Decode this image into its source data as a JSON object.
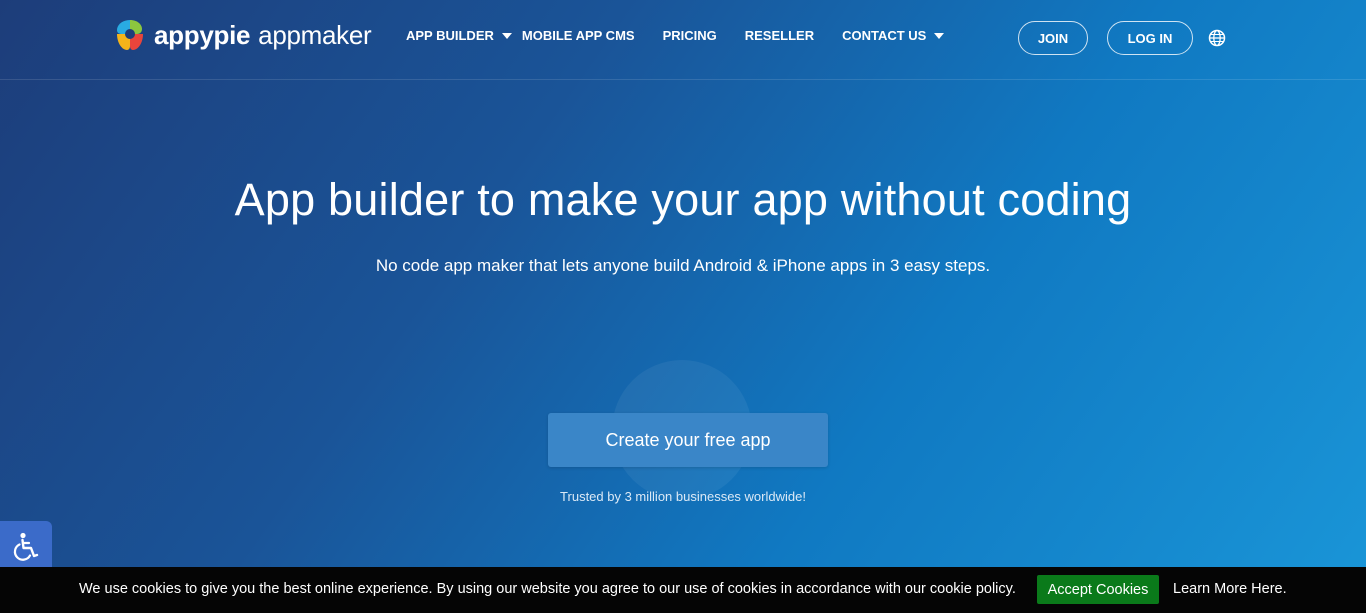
{
  "brand": {
    "name_bold": "appypie",
    "name_light": "appmaker",
    "logo_icon": "appypie-logo-icon",
    "colors": [
      "#f4b41a",
      "#8cc63f",
      "#e8453c",
      "#29abe2"
    ]
  },
  "nav": {
    "items": [
      {
        "label": "APP BUILDER",
        "dropdown": true
      },
      {
        "label": "MOBILE APP CMS",
        "dropdown": false
      },
      {
        "label": "PRICING",
        "dropdown": false
      },
      {
        "label": "RESELLER",
        "dropdown": false
      },
      {
        "label": "CONTACT US",
        "dropdown": true
      }
    ],
    "join_label": "JOIN",
    "login_label": "LOG IN",
    "language_icon": "globe-icon"
  },
  "hero": {
    "title": "App builder to make your app without coding",
    "subtitle": "No code app maker that lets anyone build Android & iPhone apps in 3 easy steps.",
    "cta_label": "Create your free app",
    "trusted_text": "Trusted by 3 million businesses worldwide!"
  },
  "accessibility": {
    "icon": "wheelchair-icon",
    "color": "#3b6bc9"
  },
  "cookie": {
    "text": "We use cookies to give you the best online experience. By using our website you agree to our use of cookies in accordance with our cookie policy.",
    "accept_label": "Accept Cookies",
    "learn_label": "Learn More Here.",
    "accept_color": "#0a7a1a"
  }
}
